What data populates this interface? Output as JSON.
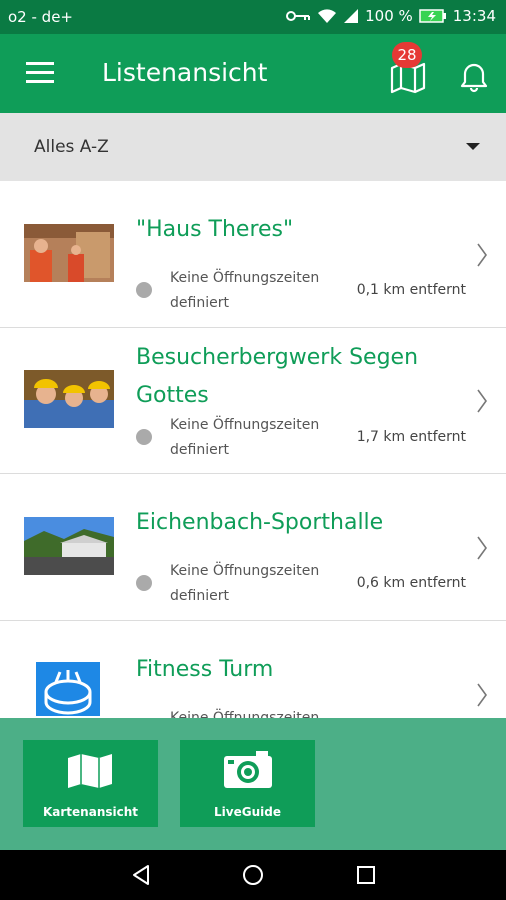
{
  "status_bar": {
    "carrier": "o2 - de+",
    "battery": "100 %",
    "time": "13:34"
  },
  "app_bar": {
    "title": "Listenansicht",
    "badge_count": "28"
  },
  "filter": {
    "label": "Alles A-Z"
  },
  "items": [
    {
      "name": "\"Haus Theres\"",
      "hours": "Keine Öffnungszeiten definiert",
      "distance": "0,1 km entfernt"
    },
    {
      "name": "Besucherbergwerk Segen Gottes",
      "hours": "Keine Öffnungszeiten definiert",
      "distance": "1,7 km entfernt"
    },
    {
      "name": "Eichenbach-Sporthalle",
      "hours": "Keine Öffnungszeiten definiert",
      "distance": "0,6 km entfernt"
    },
    {
      "name": "Fitness Turm",
      "hours": "Keine Öffnungszeiten definiert",
      "distance": ""
    }
  ],
  "bottom": {
    "map_label": "Kartenansicht",
    "live_label": "LiveGuide"
  },
  "colors": {
    "primary": "#0f9d58",
    "status_bar": "#0a7a43",
    "panel": "#4caf87",
    "badge": "#e53935"
  },
  "icons": [
    "menu-icon",
    "map-icon",
    "bell-icon",
    "chevron-right-icon",
    "camera-icon",
    "back-icon",
    "home-icon",
    "recents-icon",
    "wifi-icon",
    "key-icon",
    "signal-icon",
    "battery-icon"
  ]
}
